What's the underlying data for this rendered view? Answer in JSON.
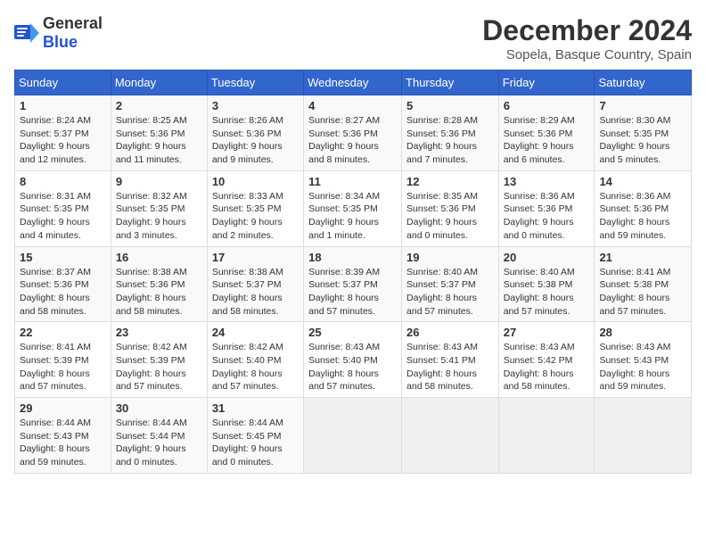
{
  "logo": {
    "general": "General",
    "blue": "Blue"
  },
  "title": "December 2024",
  "subtitle": "Sopela, Basque Country, Spain",
  "weekdays": [
    "Sunday",
    "Monday",
    "Tuesday",
    "Wednesday",
    "Thursday",
    "Friday",
    "Saturday"
  ],
  "weeks": [
    [
      {
        "day": "1",
        "sunrise": "8:24 AM",
        "sunset": "5:37 PM",
        "daylight": "9 hours and 12 minutes."
      },
      {
        "day": "2",
        "sunrise": "8:25 AM",
        "sunset": "5:36 PM",
        "daylight": "9 hours and 11 minutes."
      },
      {
        "day": "3",
        "sunrise": "8:26 AM",
        "sunset": "5:36 PM",
        "daylight": "9 hours and 9 minutes."
      },
      {
        "day": "4",
        "sunrise": "8:27 AM",
        "sunset": "5:36 PM",
        "daylight": "9 hours and 8 minutes."
      },
      {
        "day": "5",
        "sunrise": "8:28 AM",
        "sunset": "5:36 PM",
        "daylight": "9 hours and 7 minutes."
      },
      {
        "day": "6",
        "sunrise": "8:29 AM",
        "sunset": "5:36 PM",
        "daylight": "9 hours and 6 minutes."
      },
      {
        "day": "7",
        "sunrise": "8:30 AM",
        "sunset": "5:35 PM",
        "daylight": "9 hours and 5 minutes."
      }
    ],
    [
      {
        "day": "8",
        "sunrise": "8:31 AM",
        "sunset": "5:35 PM",
        "daylight": "9 hours and 4 minutes."
      },
      {
        "day": "9",
        "sunrise": "8:32 AM",
        "sunset": "5:35 PM",
        "daylight": "9 hours and 3 minutes."
      },
      {
        "day": "10",
        "sunrise": "8:33 AM",
        "sunset": "5:35 PM",
        "daylight": "9 hours and 2 minutes."
      },
      {
        "day": "11",
        "sunrise": "8:34 AM",
        "sunset": "5:35 PM",
        "daylight": "9 hours and 1 minute."
      },
      {
        "day": "12",
        "sunrise": "8:35 AM",
        "sunset": "5:36 PM",
        "daylight": "9 hours and 0 minutes."
      },
      {
        "day": "13",
        "sunrise": "8:36 AM",
        "sunset": "5:36 PM",
        "daylight": "9 hours and 0 minutes."
      },
      {
        "day": "14",
        "sunrise": "8:36 AM",
        "sunset": "5:36 PM",
        "daylight": "8 hours and 59 minutes."
      }
    ],
    [
      {
        "day": "15",
        "sunrise": "8:37 AM",
        "sunset": "5:36 PM",
        "daylight": "8 hours and 58 minutes."
      },
      {
        "day": "16",
        "sunrise": "8:38 AM",
        "sunset": "5:36 PM",
        "daylight": "8 hours and 58 minutes."
      },
      {
        "day": "17",
        "sunrise": "8:38 AM",
        "sunset": "5:37 PM",
        "daylight": "8 hours and 58 minutes."
      },
      {
        "day": "18",
        "sunrise": "8:39 AM",
        "sunset": "5:37 PM",
        "daylight": "8 hours and 57 minutes."
      },
      {
        "day": "19",
        "sunrise": "8:40 AM",
        "sunset": "5:37 PM",
        "daylight": "8 hours and 57 minutes."
      },
      {
        "day": "20",
        "sunrise": "8:40 AM",
        "sunset": "5:38 PM",
        "daylight": "8 hours and 57 minutes."
      },
      {
        "day": "21",
        "sunrise": "8:41 AM",
        "sunset": "5:38 PM",
        "daylight": "8 hours and 57 minutes."
      }
    ],
    [
      {
        "day": "22",
        "sunrise": "8:41 AM",
        "sunset": "5:39 PM",
        "daylight": "8 hours and 57 minutes."
      },
      {
        "day": "23",
        "sunrise": "8:42 AM",
        "sunset": "5:39 PM",
        "daylight": "8 hours and 57 minutes."
      },
      {
        "day": "24",
        "sunrise": "8:42 AM",
        "sunset": "5:40 PM",
        "daylight": "8 hours and 57 minutes."
      },
      {
        "day": "25",
        "sunrise": "8:43 AM",
        "sunset": "5:40 PM",
        "daylight": "8 hours and 57 minutes."
      },
      {
        "day": "26",
        "sunrise": "8:43 AM",
        "sunset": "5:41 PM",
        "daylight": "8 hours and 58 minutes."
      },
      {
        "day": "27",
        "sunrise": "8:43 AM",
        "sunset": "5:42 PM",
        "daylight": "8 hours and 58 minutes."
      },
      {
        "day": "28",
        "sunrise": "8:43 AM",
        "sunset": "5:43 PM",
        "daylight": "8 hours and 59 minutes."
      }
    ],
    [
      {
        "day": "29",
        "sunrise": "8:44 AM",
        "sunset": "5:43 PM",
        "daylight": "8 hours and 59 minutes."
      },
      {
        "day": "30",
        "sunrise": "8:44 AM",
        "sunset": "5:44 PM",
        "daylight": "9 hours and 0 minutes."
      },
      {
        "day": "31",
        "sunrise": "8:44 AM",
        "sunset": "5:45 PM",
        "daylight": "9 hours and 0 minutes."
      },
      null,
      null,
      null,
      null
    ]
  ]
}
